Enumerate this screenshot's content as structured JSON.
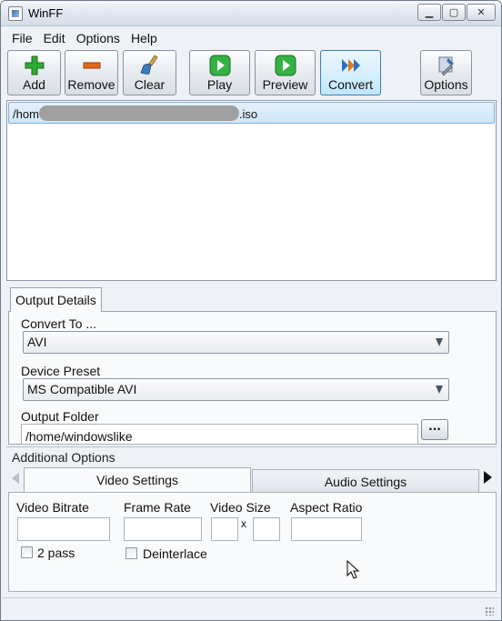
{
  "window": {
    "title": "WinFF"
  },
  "menu": [
    "File",
    "Edit",
    "Options",
    "Help"
  ],
  "toolbar": {
    "add": "Add",
    "remove": "Remove",
    "clear": "Clear",
    "play": "Play",
    "preview": "Preview",
    "convert": "Convert",
    "options": "Options"
  },
  "files": {
    "row_prefix": "/hom",
    "row_suffix": ".iso"
  },
  "output": {
    "tab": "Output Details",
    "convert_to_label": "Convert To ...",
    "convert_to_value": "AVI",
    "device_preset_label": "Device Preset",
    "device_preset_value": "MS Compatible AVI",
    "output_folder_label": "Output Folder",
    "output_folder_value": "/home/windowslike",
    "browse_button": "..."
  },
  "additional": {
    "title": "Additional Options",
    "tab_video": "Video Settings",
    "tab_audio": "Audio Settings",
    "video_bitrate": "Video Bitrate",
    "frame_rate": "Frame Rate",
    "video_size": "Video Size",
    "size_x": "x",
    "aspect_ratio": "Aspect Ratio",
    "two_pass": "2 pass",
    "deinterlace": "Deinterlace"
  },
  "colors": {
    "accent": "#3c7fb1",
    "selection": "#cfe6f8",
    "background": "#eef1f5"
  }
}
